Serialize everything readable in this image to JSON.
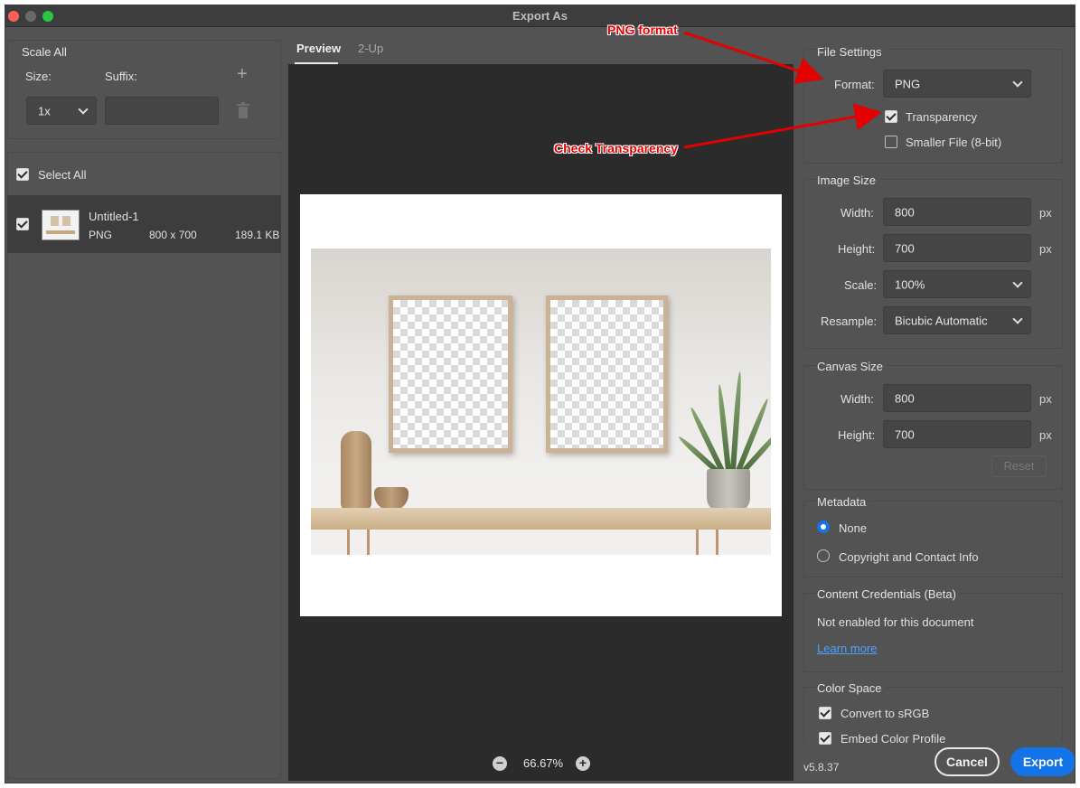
{
  "window": {
    "title": "Export As"
  },
  "left_panel": {
    "scale_all_title": "Scale All",
    "size_label": "Size:",
    "suffix_label": "Suffix:",
    "size_value": "1x",
    "suffix_value": "",
    "select_all_label": "Select All",
    "file": {
      "name": "Untitled-1",
      "format": "PNG",
      "dimensions": "800 x 700",
      "size": "189.1 KB"
    }
  },
  "preview": {
    "tabs": [
      "Preview",
      "2-Up"
    ],
    "zoom": "66.67%"
  },
  "file_settings": {
    "title": "File Settings",
    "format_label": "Format:",
    "format_value": "PNG",
    "transparency_label": "Transparency",
    "transparency_checked": true,
    "smaller_file_label": "Smaller File (8-bit)",
    "smaller_file_checked": false
  },
  "image_size": {
    "title": "Image Size",
    "width_label": "Width:",
    "width_value": "800",
    "height_label": "Height:",
    "height_value": "700",
    "scale_label": "Scale:",
    "scale_value": "100%",
    "resample_label": "Resample:",
    "resample_value": "Bicubic Automatic",
    "unit": "px"
  },
  "canvas_size": {
    "title": "Canvas Size",
    "width_label": "Width:",
    "width_value": "800",
    "height_label": "Height:",
    "height_value": "700",
    "unit": "px",
    "reset_label": "Reset"
  },
  "metadata": {
    "title": "Metadata",
    "options": [
      "None",
      "Copyright and Contact Info"
    ],
    "selected": "None"
  },
  "content_credentials": {
    "title": "Content Credentials (Beta)",
    "status": "Not enabled for this document",
    "link": "Learn more"
  },
  "color_space": {
    "title": "Color Space",
    "convert_label": "Convert to sRGB",
    "embed_label": "Embed Color Profile"
  },
  "footer": {
    "version": "v5.8.37",
    "cancel_label": "Cancel",
    "export_label": "Export"
  },
  "annotations": {
    "png_format": "PNG format",
    "check_transparency": "Check Transparency",
    "color": "#e40000"
  }
}
